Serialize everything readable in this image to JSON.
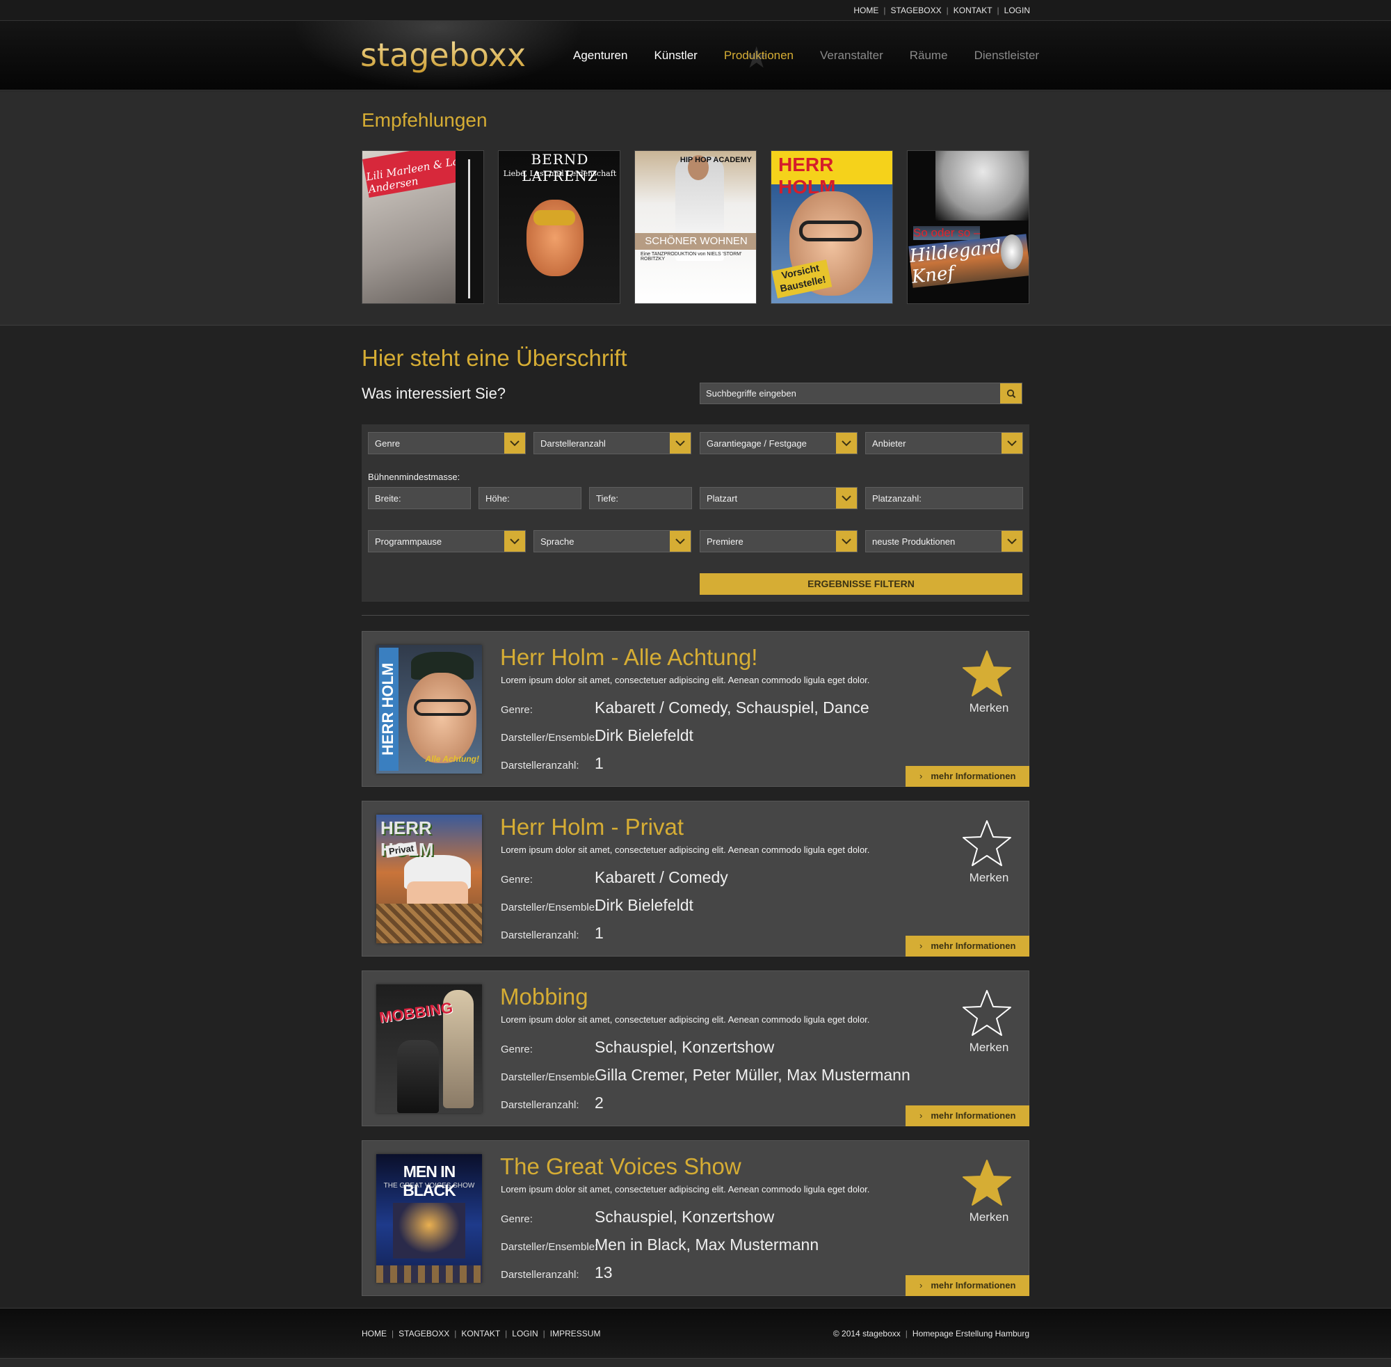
{
  "topnav": {
    "items": [
      "HOME",
      "STAGEBOXX",
      "KONTAKT",
      "LOGIN"
    ]
  },
  "logo": "stageboxx",
  "mainnav": {
    "items": [
      {
        "label": "Agenturen",
        "state": "light"
      },
      {
        "label": "Künstler",
        "state": "light"
      },
      {
        "label": "Produktionen",
        "state": "active"
      },
      {
        "label": "Veranstalter",
        "state": "dim"
      },
      {
        "label": "Räume",
        "state": "dim"
      },
      {
        "label": "Dienstleister",
        "state": "dim"
      }
    ]
  },
  "recommendations": {
    "heading": "Empfehlungen",
    "posters": [
      {
        "banner": "Lili Marleen & Lale Andersen",
        "name": "poster-lili-marleen"
      },
      {
        "title": "BERND LAFRENZ",
        "subtitle": "Liebe, Lust und Leidenschaft",
        "name": "poster-bernd-lafrenz"
      },
      {
        "title": "SCHÖNER WOHNEN",
        "subtitle": "Eine TANZPRODUKTION von NIELS 'STORM' ROBITZKY",
        "badge": "HIP HOP ACADEMY",
        "name": "poster-schoener-wohnen"
      },
      {
        "title": "HERR HOLM",
        "sign": "Vorsicht Baustelle!",
        "name": "poster-herr-holm"
      },
      {
        "line1": "So oder so –",
        "title": "Hildegard Knef",
        "name": "poster-hildegard-knef"
      }
    ]
  },
  "search": {
    "heading": "Hier steht eine Überschrift",
    "subheading": "Was interessiert Sie?",
    "placeholder": "Suchbegriffe eingeben"
  },
  "filters": {
    "row1": [
      "Genre",
      "Darstelleranzahl",
      "Garantiegage / Festgage",
      "Anbieter"
    ],
    "stage_label": "Bühnenmindestmasse:",
    "inputs": [
      "Breite:",
      "Höhe:",
      "Tiefe:"
    ],
    "platzart": "Platzart",
    "platzanzahl": "Platzanzahl:",
    "row3": [
      "Programmpause",
      "Sprache",
      "Premiere",
      "neuste Produktionen"
    ],
    "submit": "ERGEBNISSE FILTERN"
  },
  "results": {
    "labels": {
      "genre": "Genre:",
      "ensemble": "Darsteller/Ensemble:",
      "count": "Darstelleranzahl:",
      "merken": "Merken",
      "more": "mehr Informationen"
    },
    "accent": "#d6ad34",
    "items": [
      {
        "title": "Herr Holm - Alle Achtung!",
        "desc": "Lorem ipsum dolor sit amet, consectetuer adipiscing elit. Aenean commodo ligula eget dolor.",
        "genre": "Kabarett / Comedy, Schauspiel, Dance",
        "ensemble": "Dirk Bielefeldt",
        "count": "1",
        "favorite": true,
        "thumb_text": "HERR HOLM",
        "thumb_sub": "Alle Achtung!"
      },
      {
        "title": "Herr Holm - Privat",
        "desc": "Lorem ipsum dolor sit amet, consectetuer adipiscing elit. Aenean commodo ligula eget dolor.",
        "genre": "Kabarett / Comedy",
        "ensemble": "Dirk Bielefeldt",
        "count": "1",
        "favorite": false,
        "thumb_text": "HERR HOLM",
        "thumb_sub": "Privat"
      },
      {
        "title": "Mobbing",
        "desc": "Lorem ipsum dolor sit amet, consectetuer adipiscing elit. Aenean commodo ligula eget dolor.",
        "genre": "Schauspiel, Konzertshow",
        "ensemble": "Gilla Cremer, Peter Müller, Max Mustermann",
        "count": "2",
        "favorite": false,
        "thumb_text": "MOBBING"
      },
      {
        "title": "The Great Voices Show",
        "desc": "Lorem ipsum dolor sit amet, consectetuer adipiscing elit. Aenean commodo ligula eget dolor.",
        "genre": "Schauspiel, Konzertshow",
        "ensemble": "Men in Black, Max Mustermann",
        "count": "13",
        "favorite": true,
        "thumb_text": "MEN IN BLACK",
        "thumb_sub": "THE GREAT VOICES SHOW"
      }
    ]
  },
  "footer": {
    "links": [
      "HOME",
      "STAGEBOXX",
      "KONTAKT",
      "LOGIN",
      "IMPRESSUM"
    ],
    "copyright": "© 2014 stageboxx",
    "credit": "Homepage Erstellung Hamburg"
  }
}
